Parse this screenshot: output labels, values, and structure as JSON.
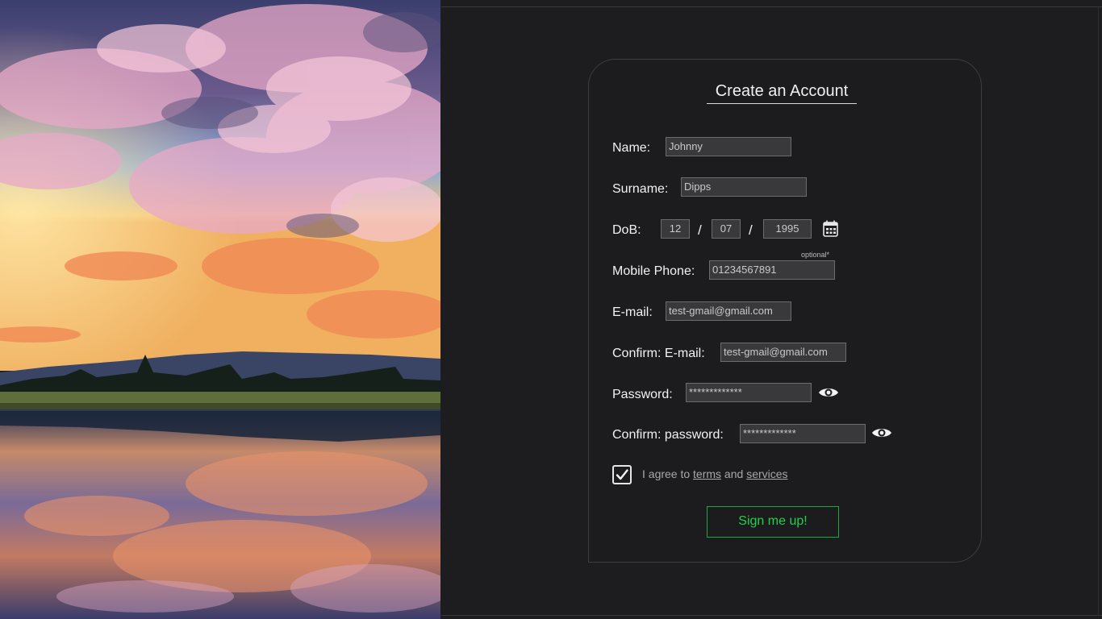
{
  "form": {
    "title": "Create an Account",
    "name": {
      "label": "Name:",
      "value": "Johnny"
    },
    "surname": {
      "label": "Surname:",
      "value": "Dipps"
    },
    "dob": {
      "label": "DoB:",
      "day": "12",
      "month": "07",
      "year": "1995",
      "separator": "/"
    },
    "mobile": {
      "label": "Mobile Phone:",
      "value": "01234567891",
      "note": "optional*"
    },
    "email": {
      "label": "E-mail:",
      "value": "test-gmail@gmail.com"
    },
    "confirm_email": {
      "label": "Confirm: E-mail:",
      "value": "test-gmail@gmail.com"
    },
    "password": {
      "label": "Password:",
      "value": "*************"
    },
    "confirm_password": {
      "label": "Confirm: password:",
      "value": "*************"
    },
    "agree": {
      "checked": true,
      "prefix": "I agree to ",
      "terms": "terms",
      "and": " and ",
      "services": "services"
    },
    "submit_label": "Sign me up!"
  },
  "icons": {
    "calendar": "calendar-icon",
    "password_eye": "eye-icon",
    "confirm_password_eye": "eye-icon",
    "checkbox": "checkmark-icon"
  },
  "colors": {
    "background": "#1d1d20",
    "input_bg": "#39393c",
    "accent_green": "#1fd24a"
  }
}
